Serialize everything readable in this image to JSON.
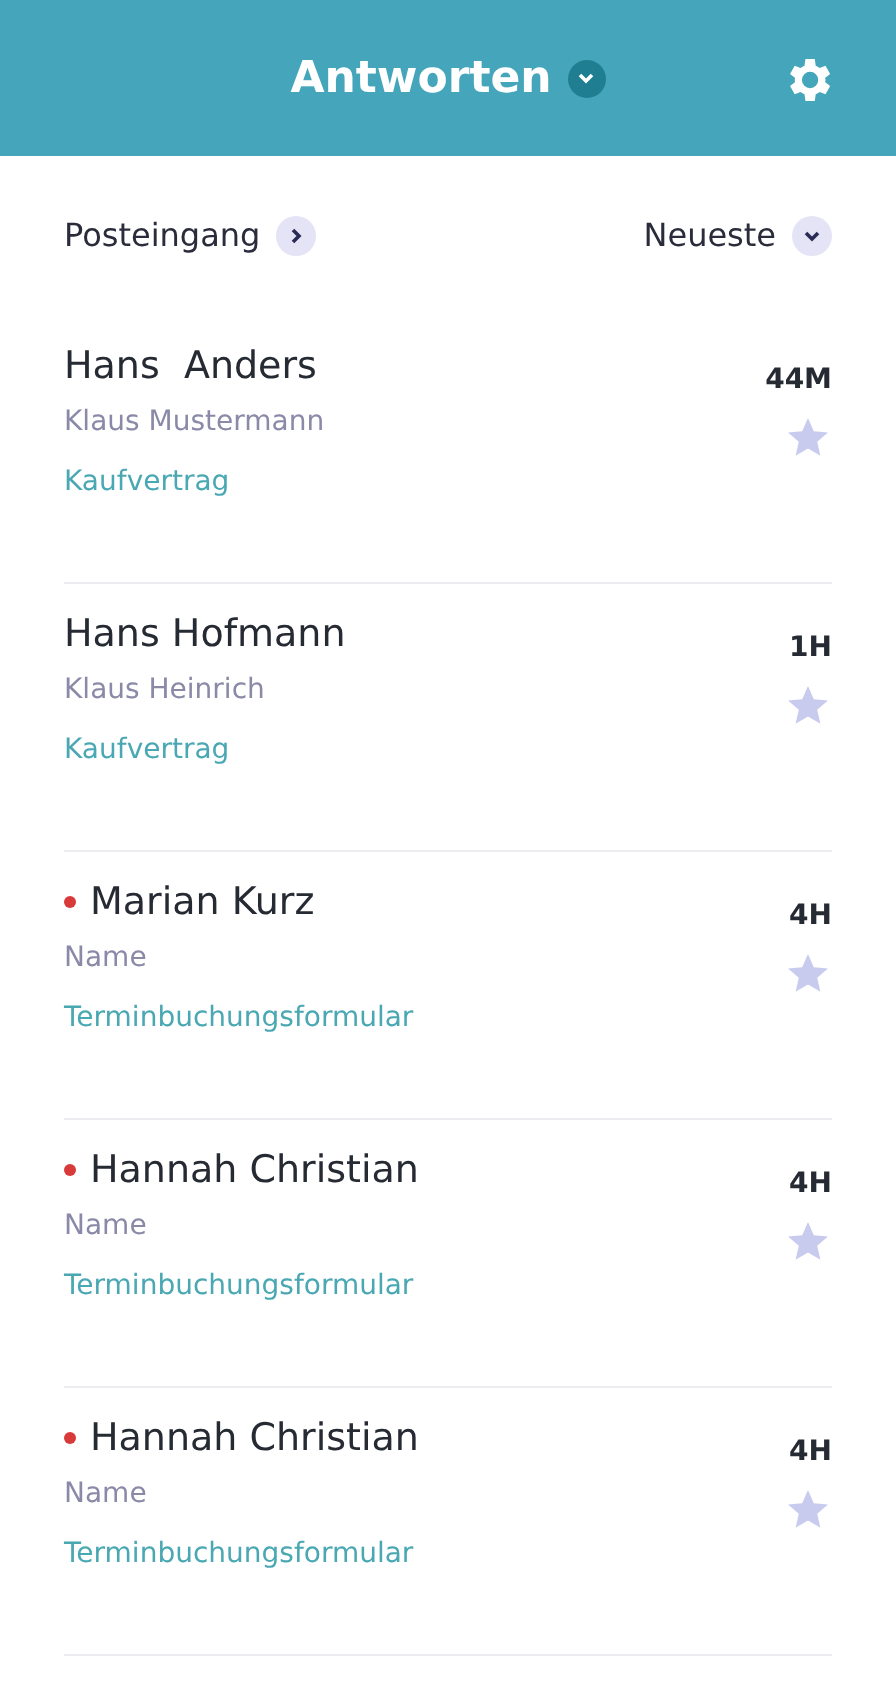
{
  "header": {
    "title": "Antworten"
  },
  "filters": {
    "folder": "Posteingang",
    "sort": "Neueste"
  },
  "responses": [
    {
      "name": "Hans  Anders",
      "sender": "Klaus Mustermann",
      "form": "Kaufvertrag",
      "time": "44M",
      "unread": false,
      "starred": false
    },
    {
      "name": "Hans Hofmann",
      "sender": "Klaus Heinrich",
      "form": "Kaufvertrag",
      "time": "1H",
      "unread": false,
      "starred": false
    },
    {
      "name": "Marian Kurz",
      "sender": "Name",
      "form": "Terminbuchungsformular",
      "time": "4H",
      "unread": true,
      "starred": false
    },
    {
      "name": "Hannah Christian",
      "sender": "Name",
      "form": "Terminbuchungsformular",
      "time": "4H",
      "unread": true,
      "starred": false
    },
    {
      "name": "Hannah Christian",
      "sender": "Name",
      "form": "Terminbuchungsformular",
      "time": "4H",
      "unread": true,
      "starred": false
    }
  ]
}
